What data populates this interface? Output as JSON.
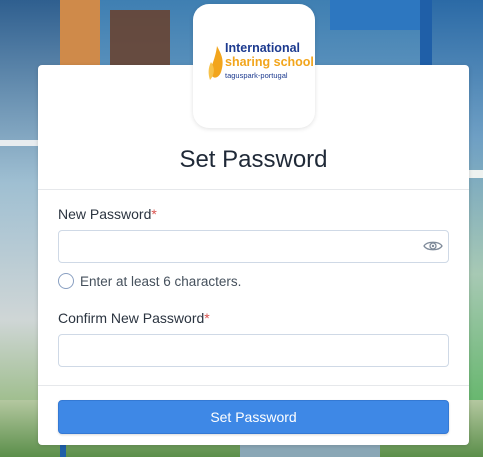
{
  "logo": {
    "line1": "International",
    "line2": "sharing school",
    "line3": "taguspark-portugal",
    "colors": {
      "navy": "#1c3a8f",
      "gold": "#f2a51c"
    }
  },
  "form": {
    "title": "Set Password",
    "new_password": {
      "label": "New Password",
      "required_mark": "*",
      "value": "",
      "placeholder": ""
    },
    "hint": "Enter at least 6 characters.",
    "confirm_password": {
      "label": "Confirm New Password",
      "required_mark": "*",
      "value": "",
      "placeholder": ""
    },
    "submit_label": "Set Password"
  },
  "colors": {
    "accent": "#3e88e6",
    "required": "#d9534f"
  },
  "icons": {
    "visibility_toggle": "eye-icon",
    "hint_status": "empty-circle-icon"
  }
}
